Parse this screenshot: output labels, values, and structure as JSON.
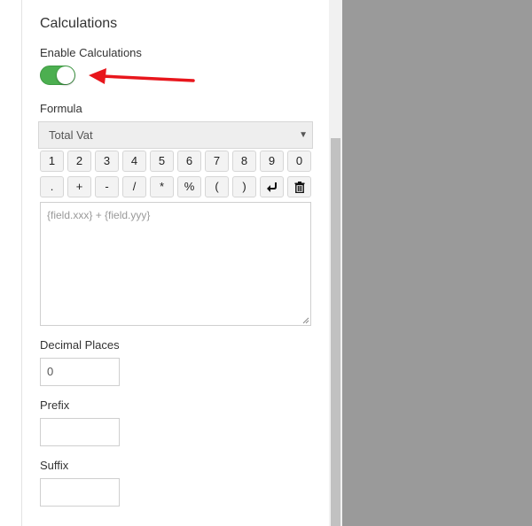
{
  "calculations": {
    "title": "Calculations",
    "enable_label": "Enable Calculations",
    "enabled": true,
    "formula_label": "Formula",
    "formula_select_value": "Total Vat",
    "keypad_row1": [
      "1",
      "2",
      "3",
      "4",
      "5",
      "6",
      "7",
      "8",
      "9",
      "0"
    ],
    "keypad_row2": [
      ".",
      "+",
      "-",
      "/",
      "*",
      "%",
      "(",
      ")"
    ],
    "keypad_icons": [
      "enter-icon",
      "trash-icon"
    ],
    "formula_placeholder": "{field.xxx} + {field.yyy}",
    "decimal_label": "Decimal Places",
    "decimal_value": "0",
    "prefix_label": "Prefix",
    "prefix_value": "",
    "suffix_label": "Suffix",
    "suffix_value": ""
  },
  "colors": {
    "toggle_on": "#4caf50",
    "arrow": "#e8161c",
    "overlay": "#9a9a9a"
  }
}
